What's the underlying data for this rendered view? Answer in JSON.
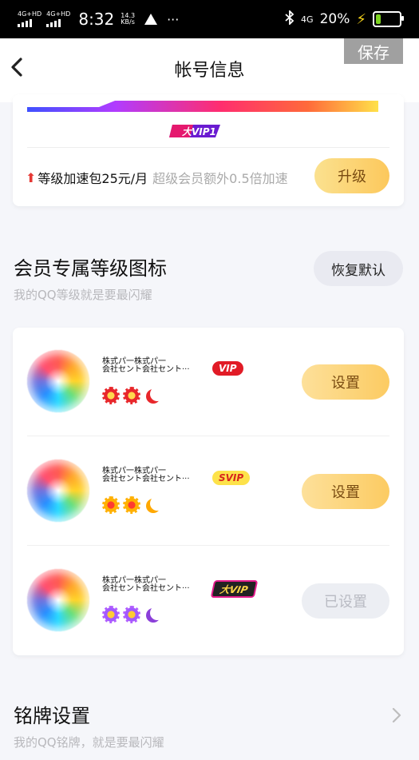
{
  "status_bar": {
    "signal1": "4G+HD",
    "signal2": "4G+HD",
    "time": "8:32",
    "net_speed_value": "14.3",
    "net_speed_unit": "KB/s",
    "battery_percent": "20%",
    "network": "4G"
  },
  "navbar": {
    "title": "帐号信息",
    "save_label": "保存"
  },
  "level_card": {
    "vip_badge": "大VIP1",
    "upgrade_text": "等级加速包25元/月",
    "upgrade_extra": "超级会员额外0.5倍加速",
    "upgrade_button": "升级"
  },
  "icons_section": {
    "title": "会员专属等级图标",
    "subtitle": "我的QQ等级就是要最闪耀",
    "restore_button": "恢复默认",
    "rows": [
      {
        "name_line1": "株式パ一株式パ一",
        "name_line2": "会社セント会社セント",
        "ellipsis": "···",
        "tag": "VIP",
        "button": "设置"
      },
      {
        "name_line1": "株式パ一株式パ一",
        "name_line2": "会社セント会社セント",
        "ellipsis": "···",
        "tag": "SVIP",
        "button": "设置"
      },
      {
        "name_line1": "株式パ一株式パ一",
        "name_line2": "会社セント会社セント",
        "ellipsis": "···",
        "tag": "大VIP",
        "button": "已设置"
      }
    ]
  },
  "badge_section": {
    "title": "铭牌设置",
    "subtitle": "我的QQ铭牌，就是要最闪耀"
  },
  "colors": {
    "accent_gold": "#fcc85c",
    "vip_red": "#e11b26",
    "svip_yellow": "#fde24a"
  }
}
